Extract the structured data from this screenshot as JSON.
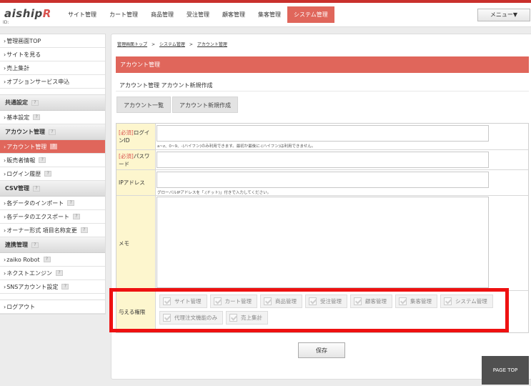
{
  "header": {
    "logo_main": "aiship",
    "logo_accent": "R",
    "id_label": "ID:",
    "nav": [
      "サイト管理",
      "カート管理",
      "商品管理",
      "受注管理",
      "顧客管理",
      "集客管理",
      "システム管理"
    ],
    "active_nav": "システム管理",
    "menu_button": "メニュー▼"
  },
  "sidebar": {
    "top_links": [
      "管理画面TOP",
      "サイトを見る",
      "売上集計",
      "オプションサービス申込"
    ],
    "sections": [
      {
        "title": "共通設定",
        "items": [
          "基本設定"
        ]
      },
      {
        "title": "アカウント管理",
        "items": [
          "アカウント管理",
          "販売者情報",
          "ログイン履歴"
        ],
        "active_item": "アカウント管理"
      },
      {
        "title": "CSV管理",
        "items": [
          "各データのインポート",
          "各データのエクスポート",
          "オーナー形式 項目名称変更"
        ]
      },
      {
        "title": "連携管理",
        "items": [
          "zaiko Robot",
          "ネクストエンジン",
          "SNSアカウント設定"
        ]
      }
    ],
    "logout": "ログアウト",
    "help_mark": "?",
    "chevron": "›"
  },
  "breadcrumb": {
    "items": [
      "管理画面トップ",
      "システム管理",
      "アカウント管理"
    ],
    "separator": ">"
  },
  "page_title": "アカウント管理",
  "subheading": "アカウント管理 アカウント新規作成",
  "tabs": [
    "アカウント一覧",
    "アカウント新規作成"
  ],
  "form": {
    "required_tag": "[必須]",
    "login_id_label": "ログインID",
    "login_id_note": "a~z、0~9、-(ハイフン)のみ利用できます。最初か最後に-(ハイフン)は利用できません。",
    "password_label": "パスワード",
    "ip_label": "IPアドレス",
    "ip_note": "グローバルIPアドレスを「.(ドット)」付きで入力してください。",
    "memo_label": "メモ",
    "permissions_label": "与える権限",
    "permissions": [
      "サイト管理",
      "カート管理",
      "商品管理",
      "受注管理",
      "顧客管理",
      "集客管理",
      "システム管理",
      "代理注文機能のみ",
      "売上集計"
    ]
  },
  "save_button": "保存",
  "page_top": "PAGE TOP",
  "colors": {
    "accent": "#e0665b",
    "highlight": "#ee1111",
    "label_bg": "#fdf6ce"
  }
}
